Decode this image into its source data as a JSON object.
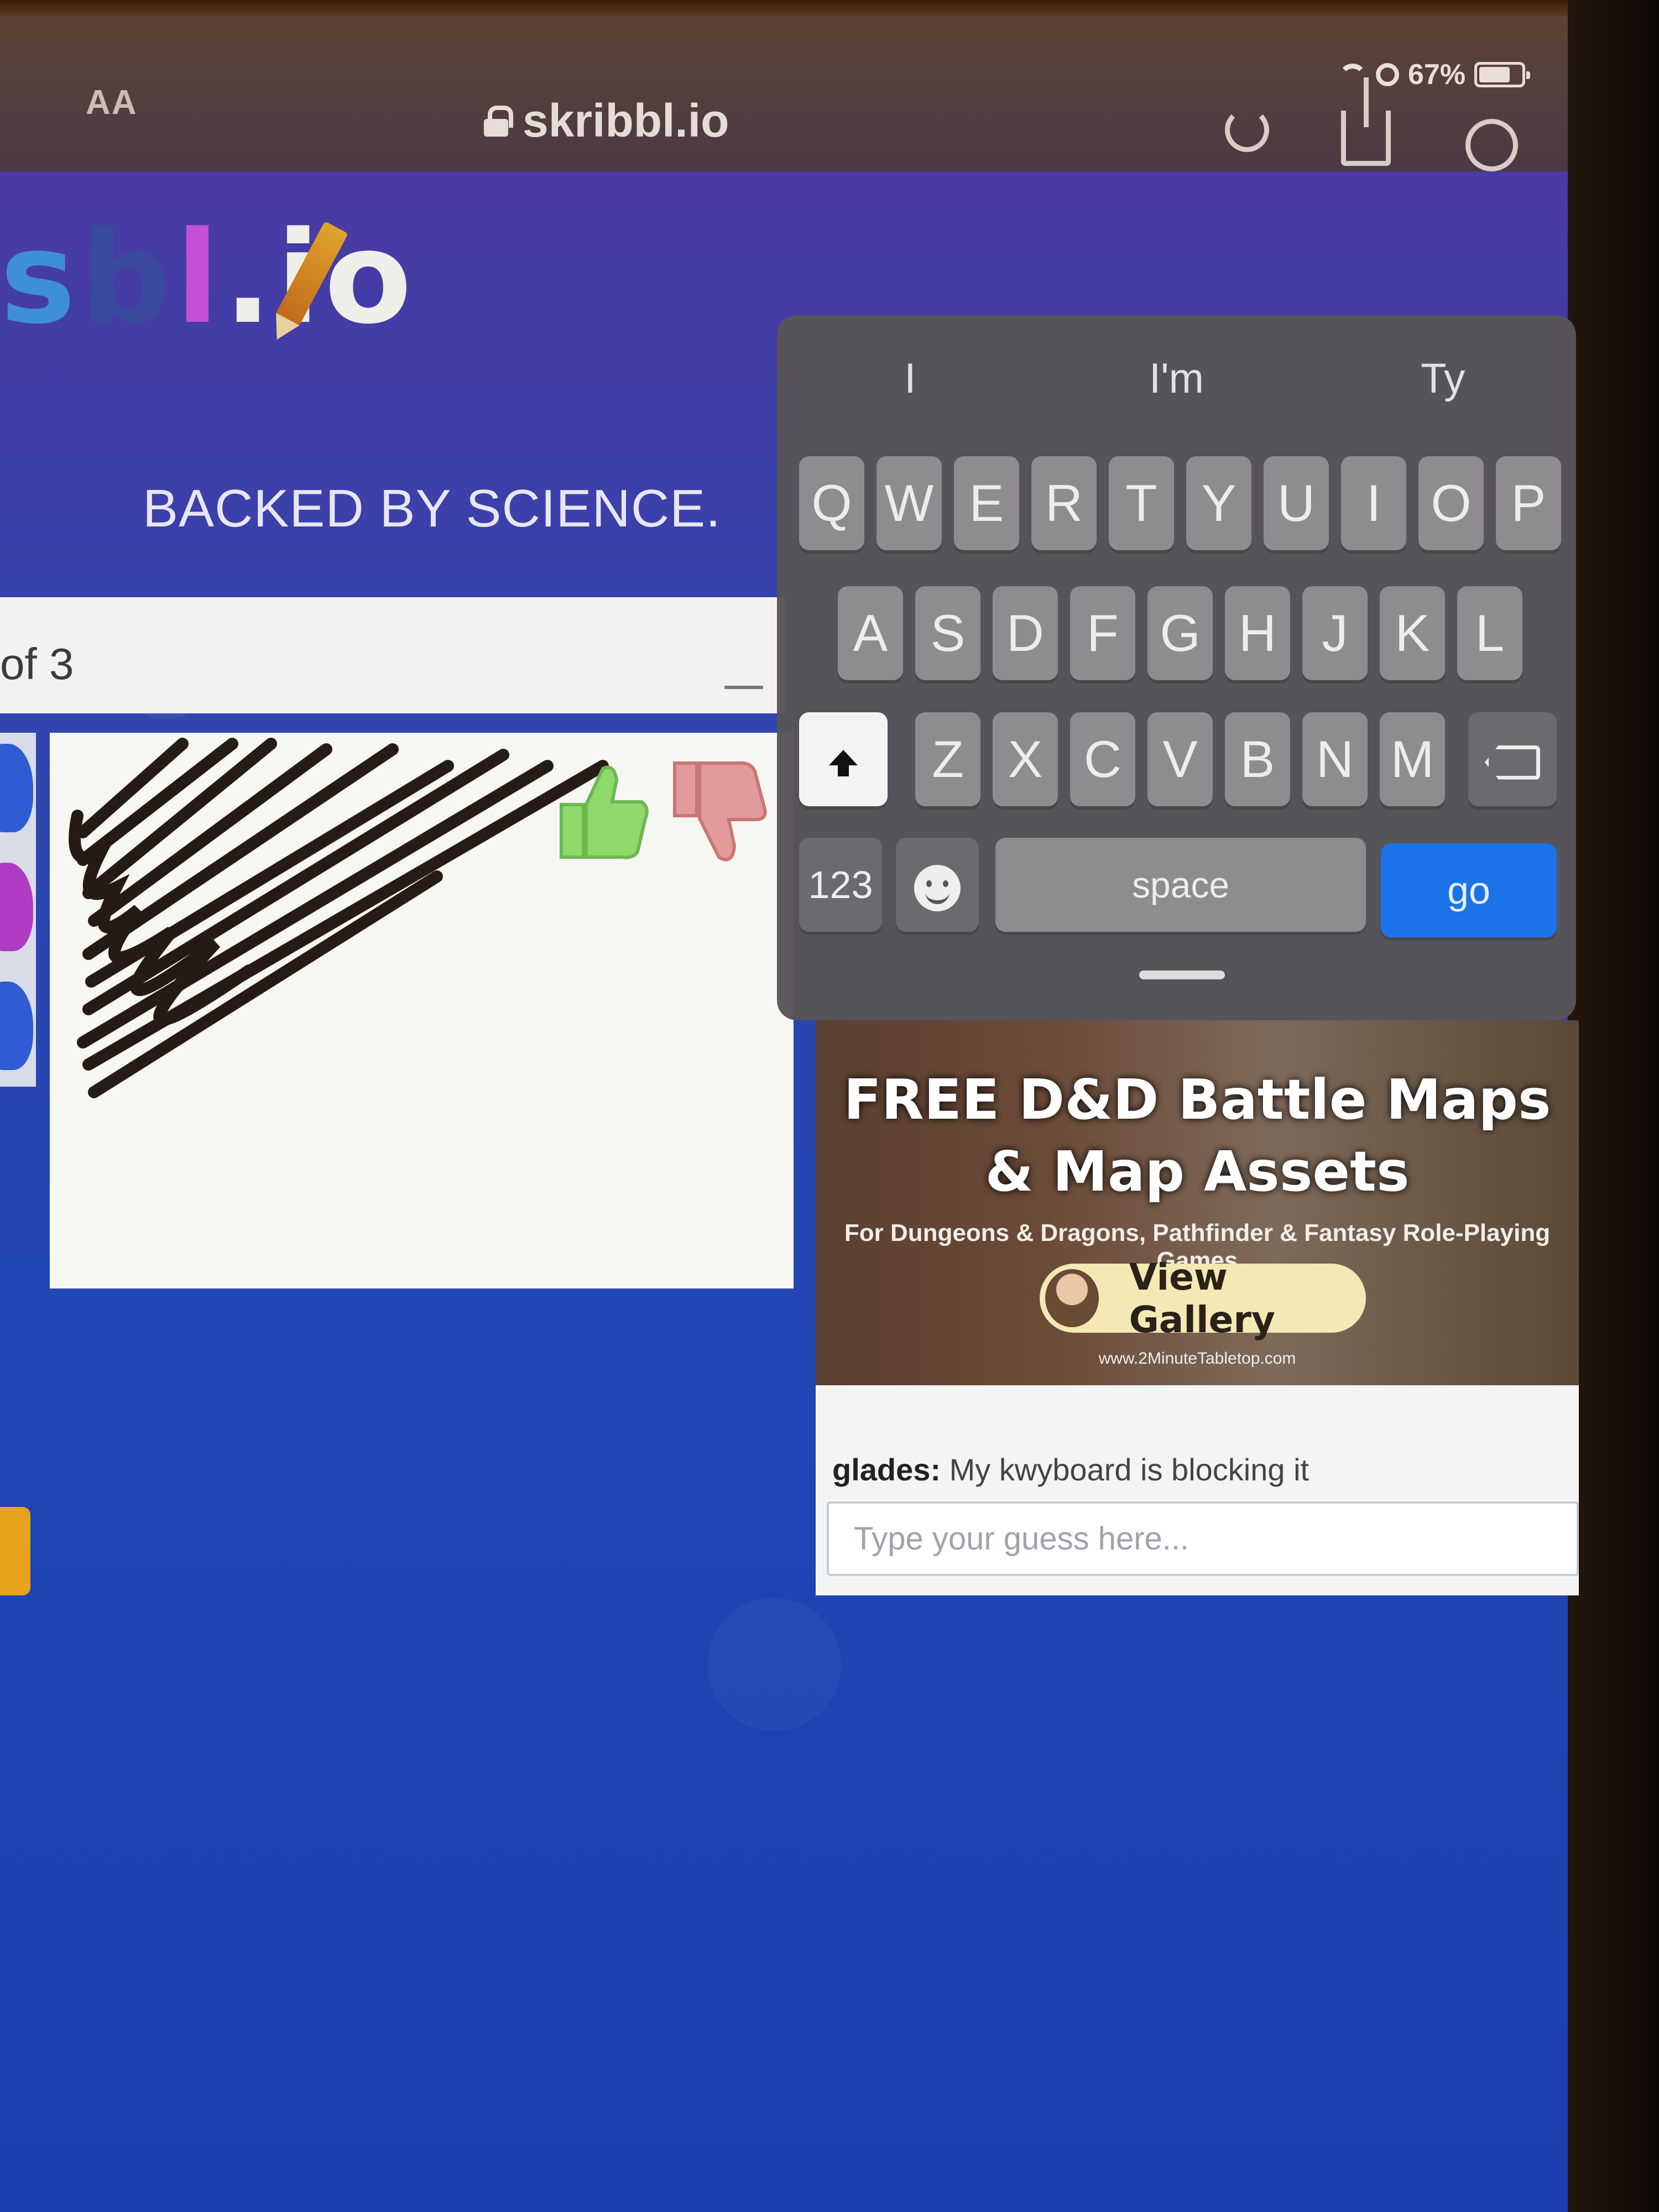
{
  "status_bar": {
    "battery": "67%",
    "wifi_icon": "wifi-icon",
    "orientation_icon": "orientation-lock-icon",
    "battery_icon": "battery-icon"
  },
  "safari": {
    "text_size_button": "AA",
    "url": "skribbl.io",
    "lock_icon": "lock-icon",
    "reload_icon": "reload-icon",
    "share_icon": "share-icon",
    "compass_icon": "compass-icon"
  },
  "page": {
    "logo_text": [
      "s",
      "b",
      "l",
      ".io"
    ],
    "tagline": "BACKED BY SCIENCE.",
    "round_text": "of 3",
    "colors": {
      "background": "#1f46b4",
      "logo_blue": "#3e8fd8",
      "logo_purple": "#c34fd4",
      "go_key": "#1a73e8",
      "thumbs_up": "#8fd86a",
      "thumbs_down": "#e39a9a"
    }
  },
  "ad": {
    "title_line1": "FREE D&D Battle Maps",
    "title_line2": "& Map Assets",
    "subtitle": "For Dungeons & Dragons, Pathfinder & Fantasy Role-Playing Games",
    "button_label": "View Gallery",
    "url": "www.2MinuteTabletop.com"
  },
  "chat": {
    "messages": [
      {
        "user": "glades:",
        "text": "My kwyboard is blocking it"
      }
    ],
    "input_placeholder": "Type your guess here..."
  },
  "keyboard": {
    "suggestions": [
      "I",
      "I'm",
      "Ty"
    ],
    "row1": [
      "Q",
      "W",
      "E",
      "R",
      "T",
      "Y",
      "U",
      "I",
      "O",
      "P"
    ],
    "row2": [
      "A",
      "S",
      "D",
      "F",
      "G",
      "H",
      "J",
      "K",
      "L"
    ],
    "row3": [
      "Z",
      "X",
      "C",
      "V",
      "B",
      "N",
      "M"
    ],
    "numbers_key": "123",
    "space_key": "space",
    "go_key": "go"
  }
}
